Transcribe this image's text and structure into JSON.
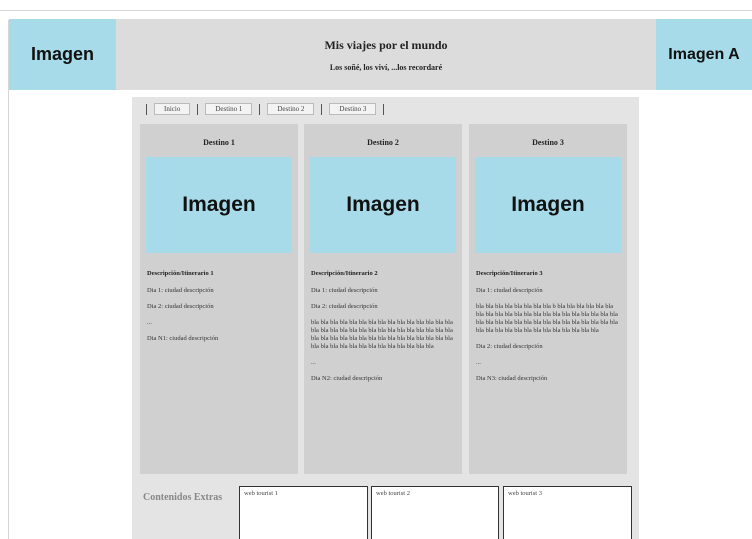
{
  "header": {
    "image_left": "Imagen",
    "image_right": "Imagen A",
    "title": "Mis viajes por el mundo",
    "subtitle": "Los soñé, los viví, ...los recordaré"
  },
  "nav": {
    "items": [
      "Inicio",
      "Destino 1",
      "Destino 2",
      "Destino 3"
    ]
  },
  "columns": [
    {
      "title": "Destino 1",
      "image": "Imagen",
      "heading": "Descripción/Itinerario 1",
      "lines": [
        "Dia 1: ciudad descripción",
        "Dia 2: ciudad descripción",
        "...",
        "Dia N1: ciudad descripción"
      ]
    },
    {
      "title": "Destino 2",
      "image": "Imagen",
      "heading": "Descripción/Itinerario 2",
      "lines": [
        "Dia 1: ciudad descripción",
        "Dia 2: ciudad descripción",
        "bla bla bla bla bla bla bla bla bla bla bla bla bla bla bla bla bla bla bla bla bla bla bla bla bla bla bla bla bla bla bla bla bla bla bla bla bla bla bla bla bla bla bla bla bla bla bla bla bla bla bla bla bla bla bla bla bla bla",
        "...",
        "Dia N2: ciudad descripción"
      ]
    },
    {
      "title": "Destino 3",
      "image": "Imagen",
      "heading": "Descripción/Itinerario 3",
      "lines": [
        "Dia 1: ciudad descripción",
        "bla bla bla bla bla bla bla bla b bla bla bla bla bla bla bla bla bla bla bla bla bla bla bla bla bla bla bla bla bla bla bla bla bla bla bla bla bla bla bla bla bla bla bla bla bla bla bla bla bla bla bla bla bla bla bla bla bla",
        "Dia 2: ciudad descripción",
        "...",
        "Dia N3: ciudad descripción"
      ]
    }
  ],
  "extras": {
    "label": "Contenidos Extras",
    "boxes": [
      "web tourist 1",
      "web tourist 2",
      "web tourist 3"
    ]
  }
}
